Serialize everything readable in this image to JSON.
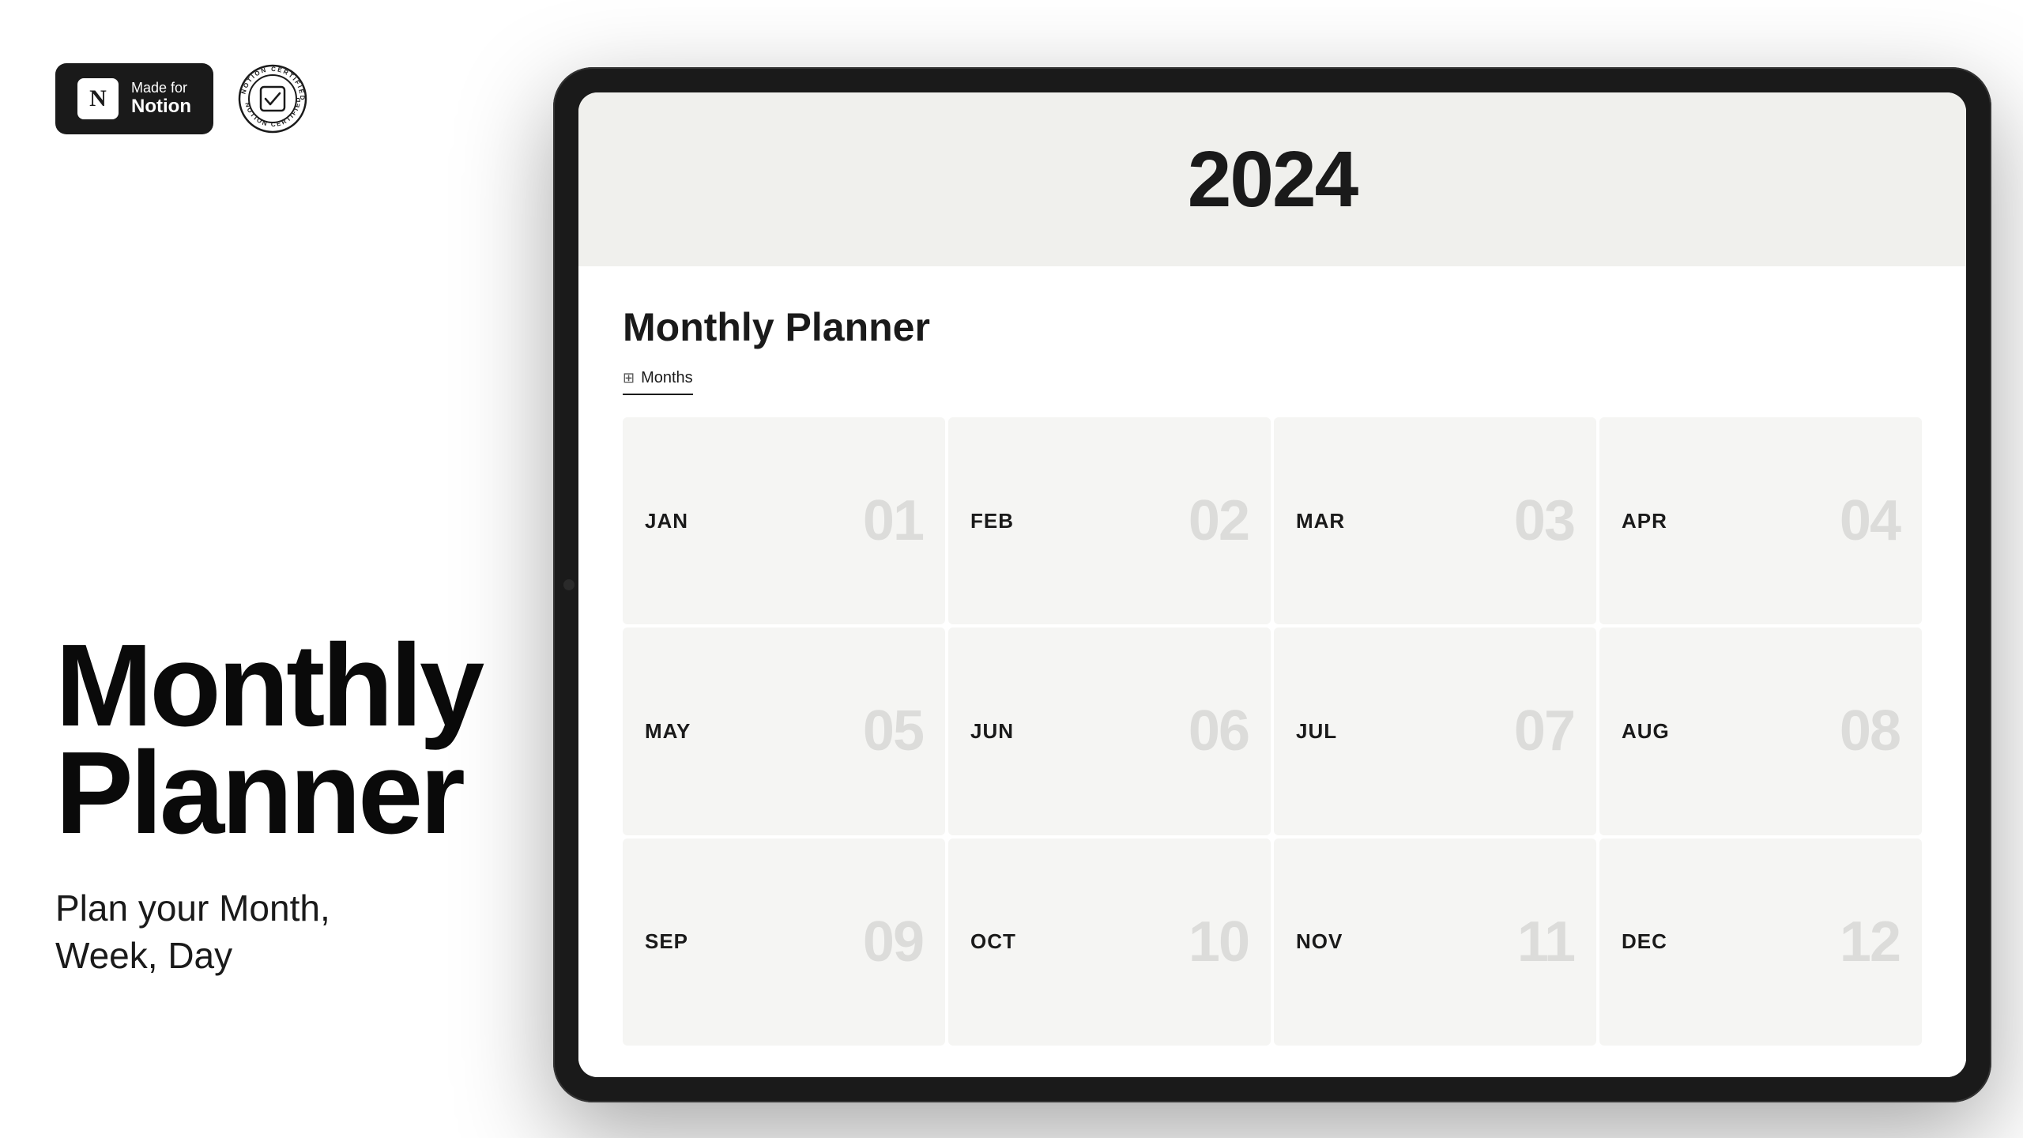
{
  "left": {
    "badge": {
      "made_for_label": "Made for",
      "notion_label": "Notion"
    },
    "certified_text_top": "NOTION CERTIFIED",
    "certified_text_bottom": "NOTION CERTIFIED",
    "hero_title_line1": "Monthly",
    "hero_title_line2": "Planner",
    "hero_subtitle_line1": "Plan your Month,",
    "hero_subtitle_line2": "Week, Day"
  },
  "tablet": {
    "year": "2024",
    "planner_title": "Monthly Planner",
    "tab_label": "Months",
    "months": [
      {
        "name": "JAN",
        "num": "01"
      },
      {
        "name": "FEB",
        "num": "02"
      },
      {
        "name": "MAR",
        "num": "03"
      },
      {
        "name": "APR",
        "num": "04"
      },
      {
        "name": "MAY",
        "num": "05"
      },
      {
        "name": "JUN",
        "num": "06"
      },
      {
        "name": "JUL",
        "num": "07"
      },
      {
        "name": "AUG",
        "num": "08"
      },
      {
        "name": "SEP",
        "num": "09"
      },
      {
        "name": "OCT",
        "num": "10"
      },
      {
        "name": "NOV",
        "num": "11"
      },
      {
        "name": "DEC",
        "num": "12"
      }
    ]
  }
}
